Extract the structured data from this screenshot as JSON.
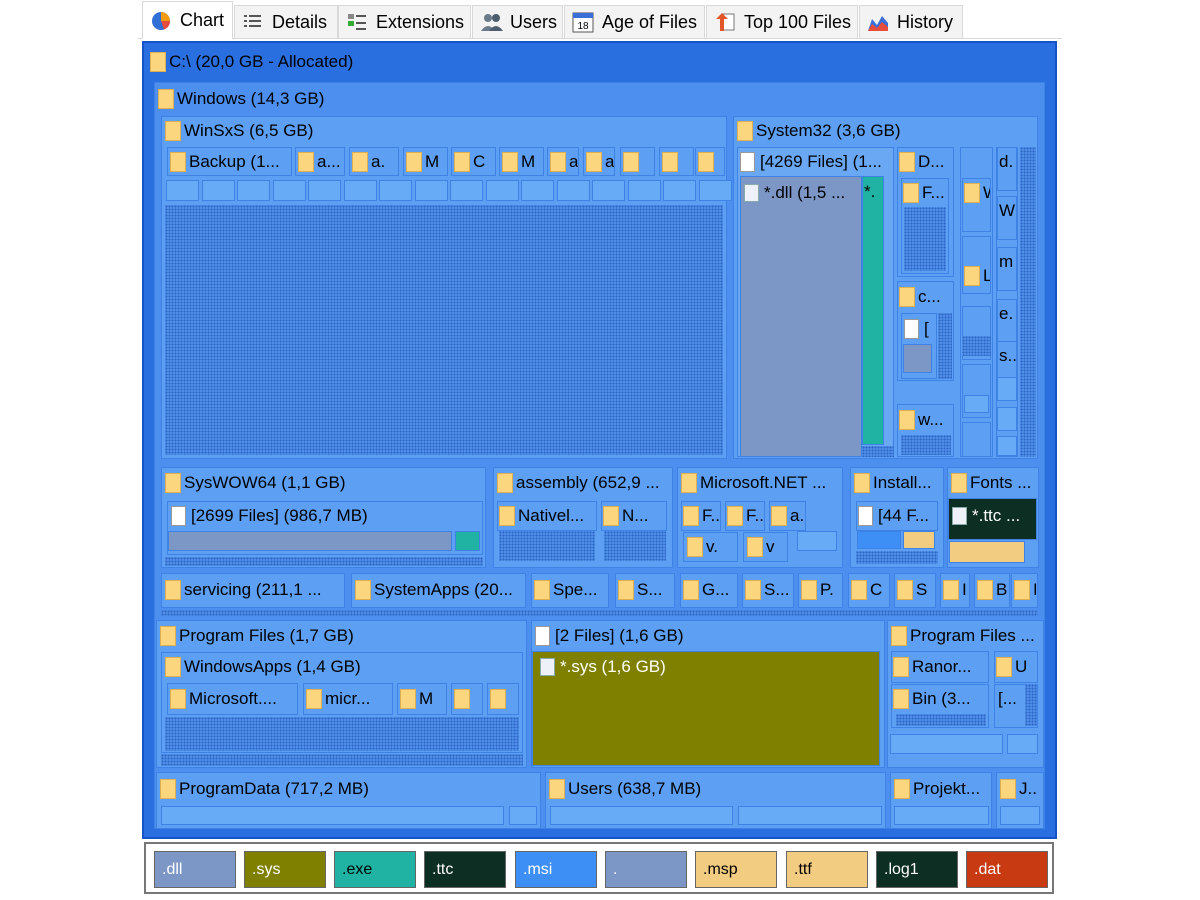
{
  "tabs": [
    {
      "label": "Chart",
      "icon": "pie-chart-icon",
      "active": true
    },
    {
      "label": "Details",
      "icon": "details-list-icon"
    },
    {
      "label": "Extensions",
      "icon": "extensions-icon"
    },
    {
      "label": "Users",
      "icon": "users-icon"
    },
    {
      "label": "Age of Files",
      "icon": "calendar-icon",
      "icon_text": "18"
    },
    {
      "label": "Top 100 Files",
      "icon": "top-files-icon"
    },
    {
      "label": "History",
      "icon": "history-chart-icon"
    }
  ],
  "treemap": {
    "root": "C:\\ (20,0 GB - Allocated)",
    "windows": "Windows (14,3 GB)",
    "winsxs": "WinSxS (6,5 GB)",
    "winsxs_children": [
      "Backup (1...",
      "a...",
      "a.",
      "M",
      "C",
      "M",
      "a",
      "a",
      "",
      ""
    ],
    "system32": "System32 (3,6 GB)",
    "sys32_files": "[4269 Files] (1...",
    "sys32_dll": "*.dll (1,5 ...",
    "sys32_star": "*.",
    "sys32_d": "D...",
    "sys32_f": "F...",
    "sys32_c": "c...",
    "sys32_bracket": "[",
    "sys32_w": "w...",
    "sys32_col2": [
      "W",
      "L."
    ],
    "sys32_col3": [
      "d.",
      "W",
      "m",
      "e.",
      "s.."
    ],
    "syswow64": "SysWOW64 (1,1 GB)",
    "syswow_files": "[2699 Files] (986,7 MB)",
    "assembly": "assembly (652,9 ...",
    "assembly_children": [
      "Nativel...",
      "N..."
    ],
    "dotnet": "Microsoft.NET ...",
    "dotnet_children": [
      "F...",
      "F...",
      "a.",
      "v.",
      "v"
    ],
    "install": "Install...",
    "install_files": "[44 F...",
    "fonts": "Fonts ...",
    "fonts_ttc": "*.ttc ...",
    "servicing": "servicing (211,1 ...",
    "systemapps": "SystemApps (20...",
    "row3_small": [
      "Spe...",
      "S...",
      "G...",
      "S...",
      "P.",
      "C",
      "S",
      "I",
      "B...",
      "I..."
    ],
    "program_files": "Program Files (1,7 GB)",
    "windowsapps": "WindowsApps (1,4 GB)",
    "windowsapps_children": [
      "Microsoft....",
      "micr...",
      "M",
      "",
      ""
    ],
    "two_files": "[2 Files] (1,6 GB)",
    "sys_file": "*.sys (1,6 GB)",
    "program_files_x86": "Program Files ...",
    "ranor": "Ranor...",
    "u": "U",
    "bin": "Bin (3...",
    "bracket_small": "[...",
    "programdata": "ProgramData (717,2 MB)",
    "users": "Users (638,7 MB)",
    "projekt": "Projekt...",
    "j": "J.."
  },
  "legend": [
    {
      "label": ".dll",
      "color": "#7c97c6",
      "text": "#fff"
    },
    {
      "label": ".sys",
      "color": "#808000",
      "text": "#fff"
    },
    {
      "label": ".exe",
      "color": "#20b2a2",
      "text": "#000"
    },
    {
      "label": ".ttc",
      "color": "#0d2e22",
      "text": "#fff"
    },
    {
      "label": ".msi",
      "color": "#3d8ef5",
      "text": "#fff"
    },
    {
      "label": ".",
      "color": "#7c97c6",
      "text": "#fff"
    },
    {
      "label": ".msp",
      "color": "#f2cc80",
      "text": "#000"
    },
    {
      "label": ".ttf",
      "color": "#f2cc80",
      "text": "#000"
    },
    {
      "label": ".log1",
      "color": "#0d2e22",
      "text": "#fff"
    },
    {
      "label": ".dat",
      "color": "#c83a12",
      "text": "#fff"
    }
  ],
  "colors": {
    "accent": "#2a6fe0",
    "folder": "#fbd67e",
    "dll": "#7c97c6",
    "sys": "#808000",
    "exe": "#20b2a2",
    "ttc": "#0d2e22"
  }
}
